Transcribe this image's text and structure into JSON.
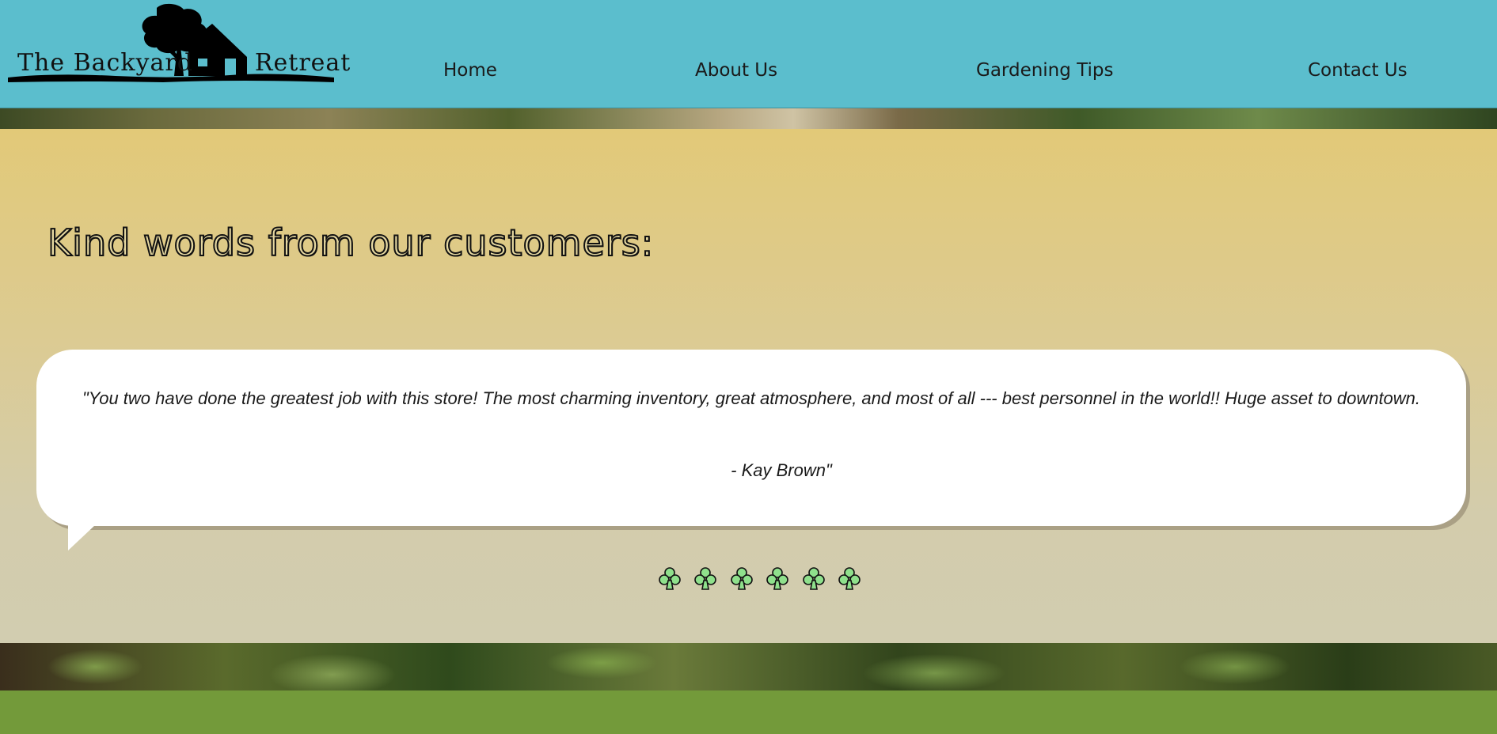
{
  "header": {
    "logo_text_left": "The Backyard",
    "logo_text_right": "Retreat",
    "nav": [
      {
        "label": "Home"
      },
      {
        "label": "About Us"
      },
      {
        "label": "Gardening Tips"
      },
      {
        "label": "Contact Us"
      }
    ]
  },
  "main": {
    "heading": "Kind words from our customers:",
    "testimonial": {
      "quote": "\"You two have done the greatest job with this store!  The most charming inventory, great atmosphere, and most of all --- best personnel in the world!!  Huge asset to downtown.",
      "author": "- Kay Brown\""
    },
    "rating_icons": [
      "club-icon",
      "club-icon",
      "club-icon",
      "club-icon",
      "club-icon",
      "club-icon"
    ]
  },
  "colors": {
    "header_bg": "#5bbecd",
    "footer_bg": "#739a3a",
    "clover_fill": "#8fe08c"
  }
}
